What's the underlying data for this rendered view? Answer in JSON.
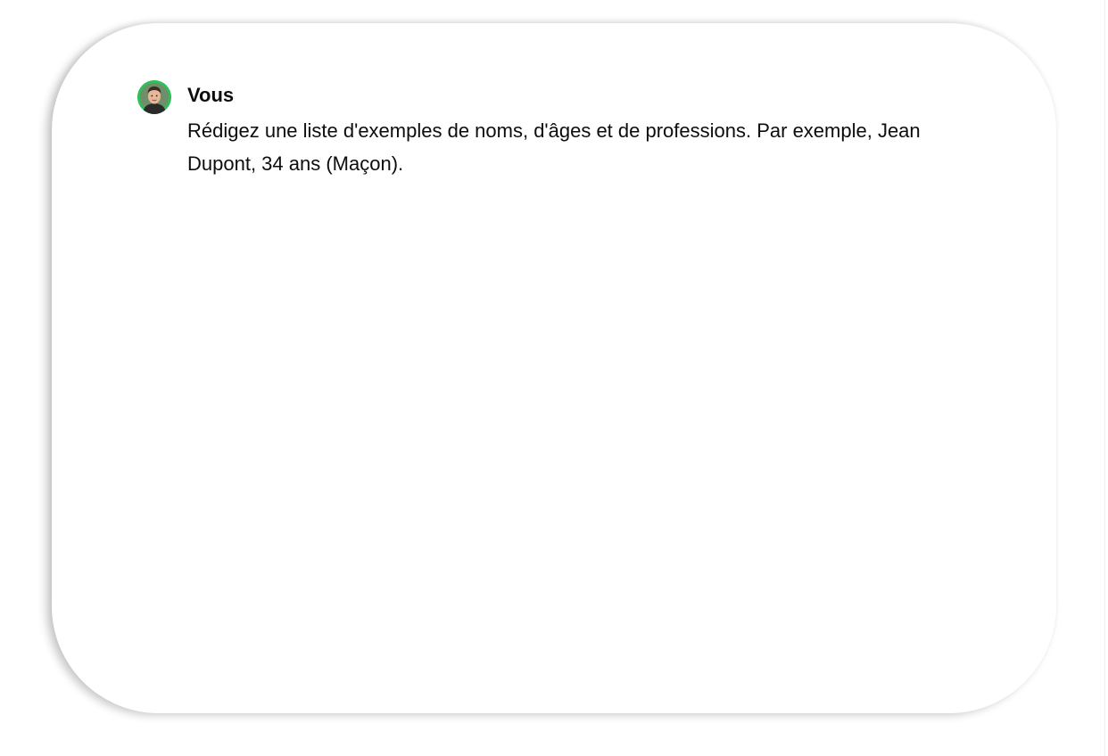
{
  "message": {
    "author": "Vous",
    "text": "Rédigez une liste d'exemples de noms, d'âges et de professions. Par exemple, Jean Dupont, 34 ans (Maçon).",
    "avatar_icon": "user-avatar-photo"
  },
  "colors": {
    "avatar_ring": "#2fbf5a",
    "text": "#0d0d0d",
    "background": "#ffffff"
  }
}
